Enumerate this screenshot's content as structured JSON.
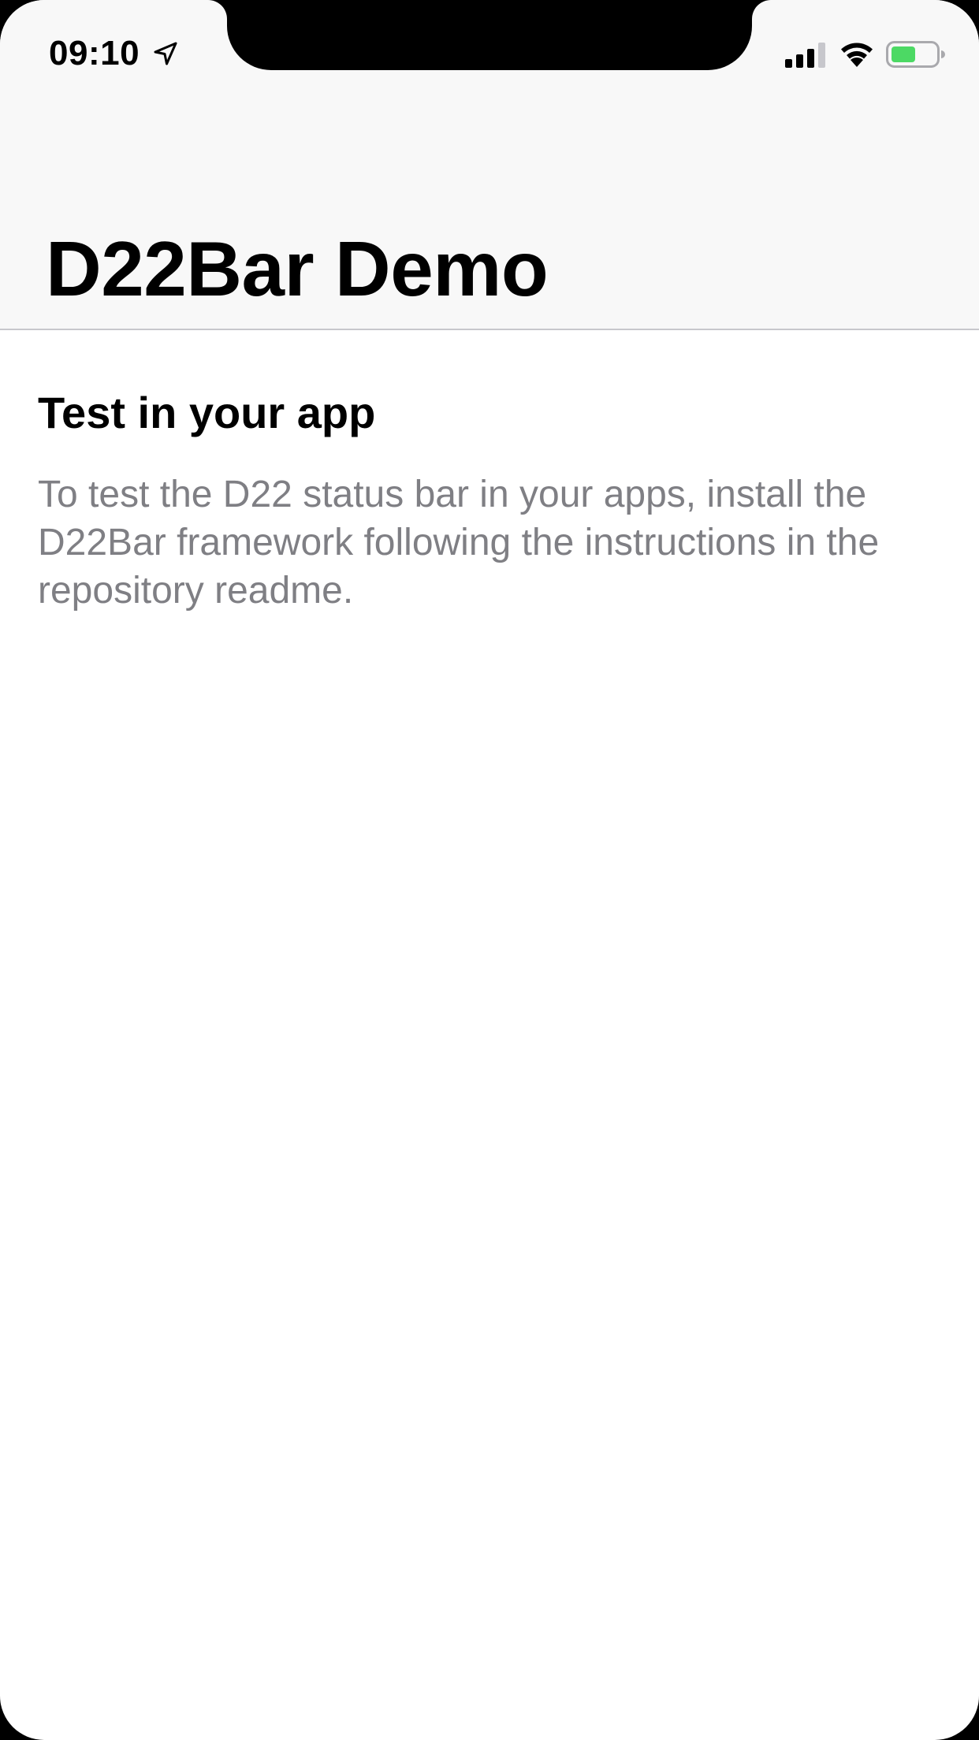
{
  "status_bar": {
    "time": "09:10",
    "icons": [
      "location-arrow-icon",
      "cellular-signal-icon",
      "wifi-icon",
      "battery-icon"
    ],
    "battery_color": "#4cd964"
  },
  "nav_bar": {
    "title": "D22Bar Demo"
  },
  "content": {
    "section_heading": "Test in your app",
    "description": "To test the D22 status bar in your apps, install the D22Bar framework following the instructions in the repository readme."
  },
  "colors": {
    "nav_background": "#f8f8f8",
    "separator": "#c8c8cc",
    "secondary_text": "#7f7f84"
  }
}
